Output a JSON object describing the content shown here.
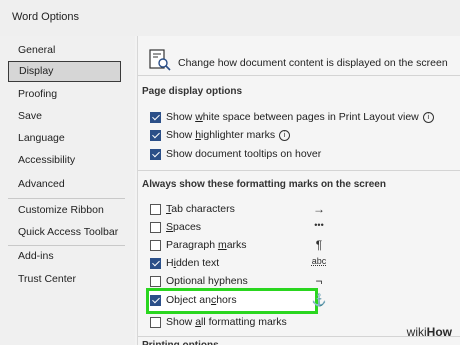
{
  "window": {
    "title": "Word Options"
  },
  "sidebar": {
    "items": [
      {
        "label": "General",
        "active": false
      },
      {
        "label": "Display",
        "active": true
      },
      {
        "label": "Proofing",
        "active": false
      },
      {
        "label": "Save",
        "active": false
      },
      {
        "label": "Language",
        "active": false
      },
      {
        "label": "Accessibility",
        "active": false
      },
      {
        "label": "Advanced",
        "active": false
      },
      {
        "label": "Customize Ribbon",
        "active": false
      },
      {
        "label": "Quick Access Toolbar",
        "active": false
      },
      {
        "label": "Add-ins",
        "active": false
      },
      {
        "label": "Trust Center",
        "active": false
      }
    ]
  },
  "content": {
    "heading": "Change how document content is displayed on the screen",
    "page_display": {
      "title": "Page display options",
      "options": [
        {
          "label": "Show white space between pages in Print Layout view",
          "checked": true,
          "info": true
        },
        {
          "label": "Show highlighter marks",
          "checked": true,
          "info": true
        },
        {
          "label": "Show document tooltips on hover",
          "checked": true,
          "info": false
        }
      ]
    },
    "formatting_marks": {
      "title": "Always show these formatting marks on the screen",
      "options": [
        {
          "label": "Tab characters",
          "checked": false,
          "symbol": "→"
        },
        {
          "label": "Spaces",
          "checked": false,
          "symbol": "•••"
        },
        {
          "label": "Paragraph marks",
          "checked": false,
          "symbol": "¶"
        },
        {
          "label": "Hidden text",
          "checked": true,
          "symbol": "abc"
        },
        {
          "label": "Optional hyphens",
          "checked": false,
          "symbol": "¬"
        },
        {
          "label": "Object anchors",
          "checked": true,
          "symbol": "⚓"
        },
        {
          "label": "Show all formatting marks",
          "checked": false,
          "symbol": ""
        }
      ]
    },
    "next_section_partial": "Printing options"
  },
  "watermark": {
    "prefix": "wiki",
    "suffix": "How"
  },
  "colors": {
    "highlight": "#2ad61f",
    "checkbox": "#2b4f88"
  }
}
